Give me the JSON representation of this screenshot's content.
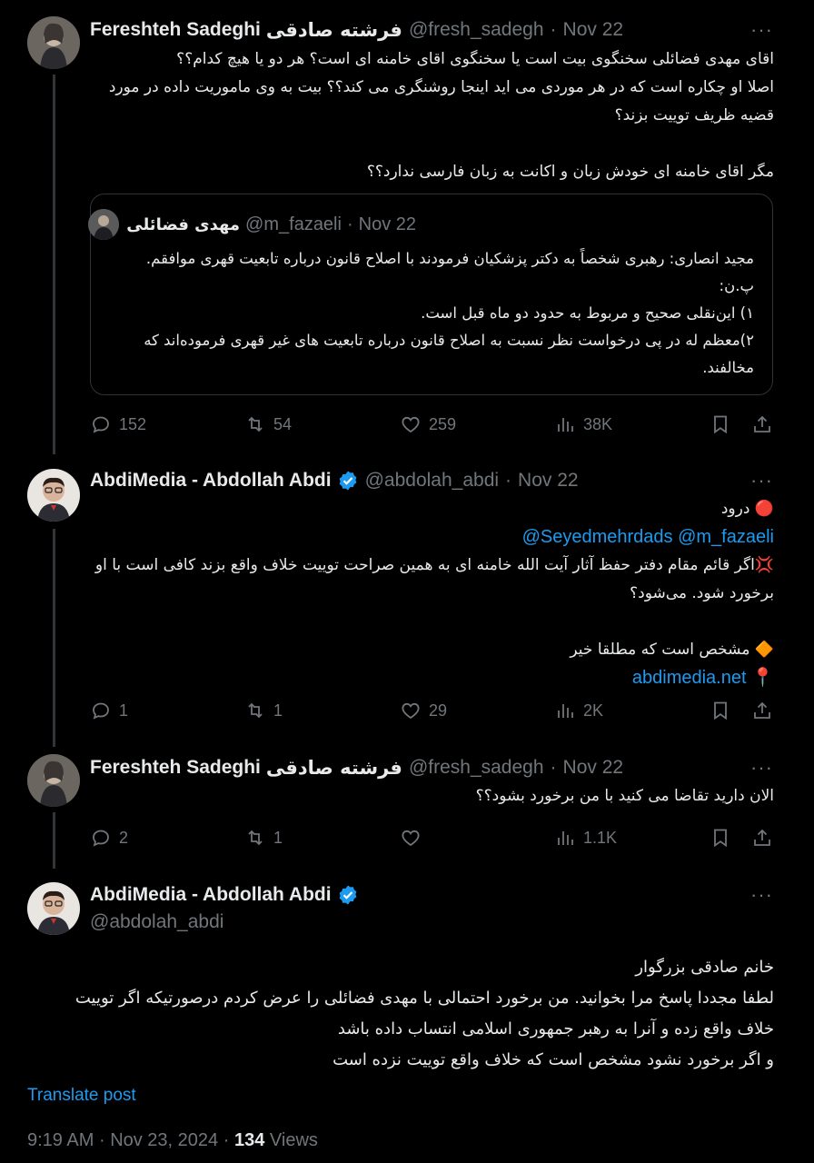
{
  "tweets": [
    {
      "name": "Fereshteh Sadeghi",
      "name_fa": "فرشته صادقی",
      "handle": "@fresh_sadegh",
      "date": "Nov 22",
      "text": "اقای مهدی فضائلی سخنگوی بیت است یا سخنگوی اقای خامنه ای است؟ هر دو یا هیچ کدام؟؟\nاصلا او چکاره است که در هر موردی می اید اینجا روشنگری می کند؟؟ بیت به وی ماموریت داده در مورد قضیه ظریف توییت بزند؟\n\nمگر اقای خامنه ای خودش زبان و اکانت به زبان فارسی ندارد؟؟",
      "quote": {
        "name": "مهدی فضائلی",
        "handle": "@m_fazaeli",
        "date": "Nov 22",
        "text": "مجید انصاری: رهبری شخصاً به دکتر پزشکیان فرمودند با اصلاح قانون درباره تابعیت قهری موافقم.\nپ.ن:\n۱) این‌نقلی صحیح و مربوط به حدود دو ماه قبل است.\n۲)معظم له در پی درخواست نظر نسبت به اصلاح قانون درباره تابعیت های غیر قهری فرموده‌اند که مخالفند."
      },
      "replies": "152",
      "reposts": "54",
      "likes": "259",
      "views": "38K"
    },
    {
      "name": "AbdiMedia - Abdollah Abdi",
      "handle": "@abdolah_abdi",
      "date": "Nov 22",
      "line1": "🔴 درود",
      "mentions": "@Seyedmehrdads @m_fazaeli",
      "line2": "💢اگر قائم مقام دفتر حفظ آثار آیت الله خامنه ای به همین صراحت توییت خلاف واقع بزند کافی است با او برخورد شود. می‌شود؟",
      "line3": "🔶 مشخص است که مطلقا خیر",
      "link_prefix": "📍",
      "link": "abdimedia.net",
      "replies": "1",
      "reposts": "1",
      "likes": "29",
      "views": "2K"
    },
    {
      "name": "Fereshteh Sadeghi",
      "name_fa": "فرشته صادقی",
      "handle": "@fresh_sadegh",
      "date": "Nov 22",
      "text": "الان دارید تقاضا می کنید با من برخورد بشود؟؟",
      "replies": "2",
      "reposts": "1",
      "likes": "",
      "views": "1.1K"
    }
  ],
  "main": {
    "name": "AbdiMedia - Abdollah Abdi",
    "handle": "@abdolah_abdi",
    "text": "خانم صادقی بزرگوار\nلطفا مجددا پاسخ مرا بخوانید. من برخورد احتمالی با مهدی فضائلی را عرض کردم درصورتیکه اگر توییت خلاف واقع زده و آنرا به رهبر جمهوری اسلامی انتساب داده باشد\nو اگر برخورد نشود مشخص است که خلاف واقع توییت نزده است",
    "translate": "Translate post",
    "time": "9:19 AM",
    "sep": "·",
    "date": "Nov 23, 2024",
    "views_count": "134",
    "views_label": "Views"
  },
  "sep": "·",
  "colors": {
    "background": "#000000",
    "text": "#e7e9ea",
    "muted": "#71767b",
    "accent": "#1d9bf0",
    "border": "#2f3336"
  }
}
